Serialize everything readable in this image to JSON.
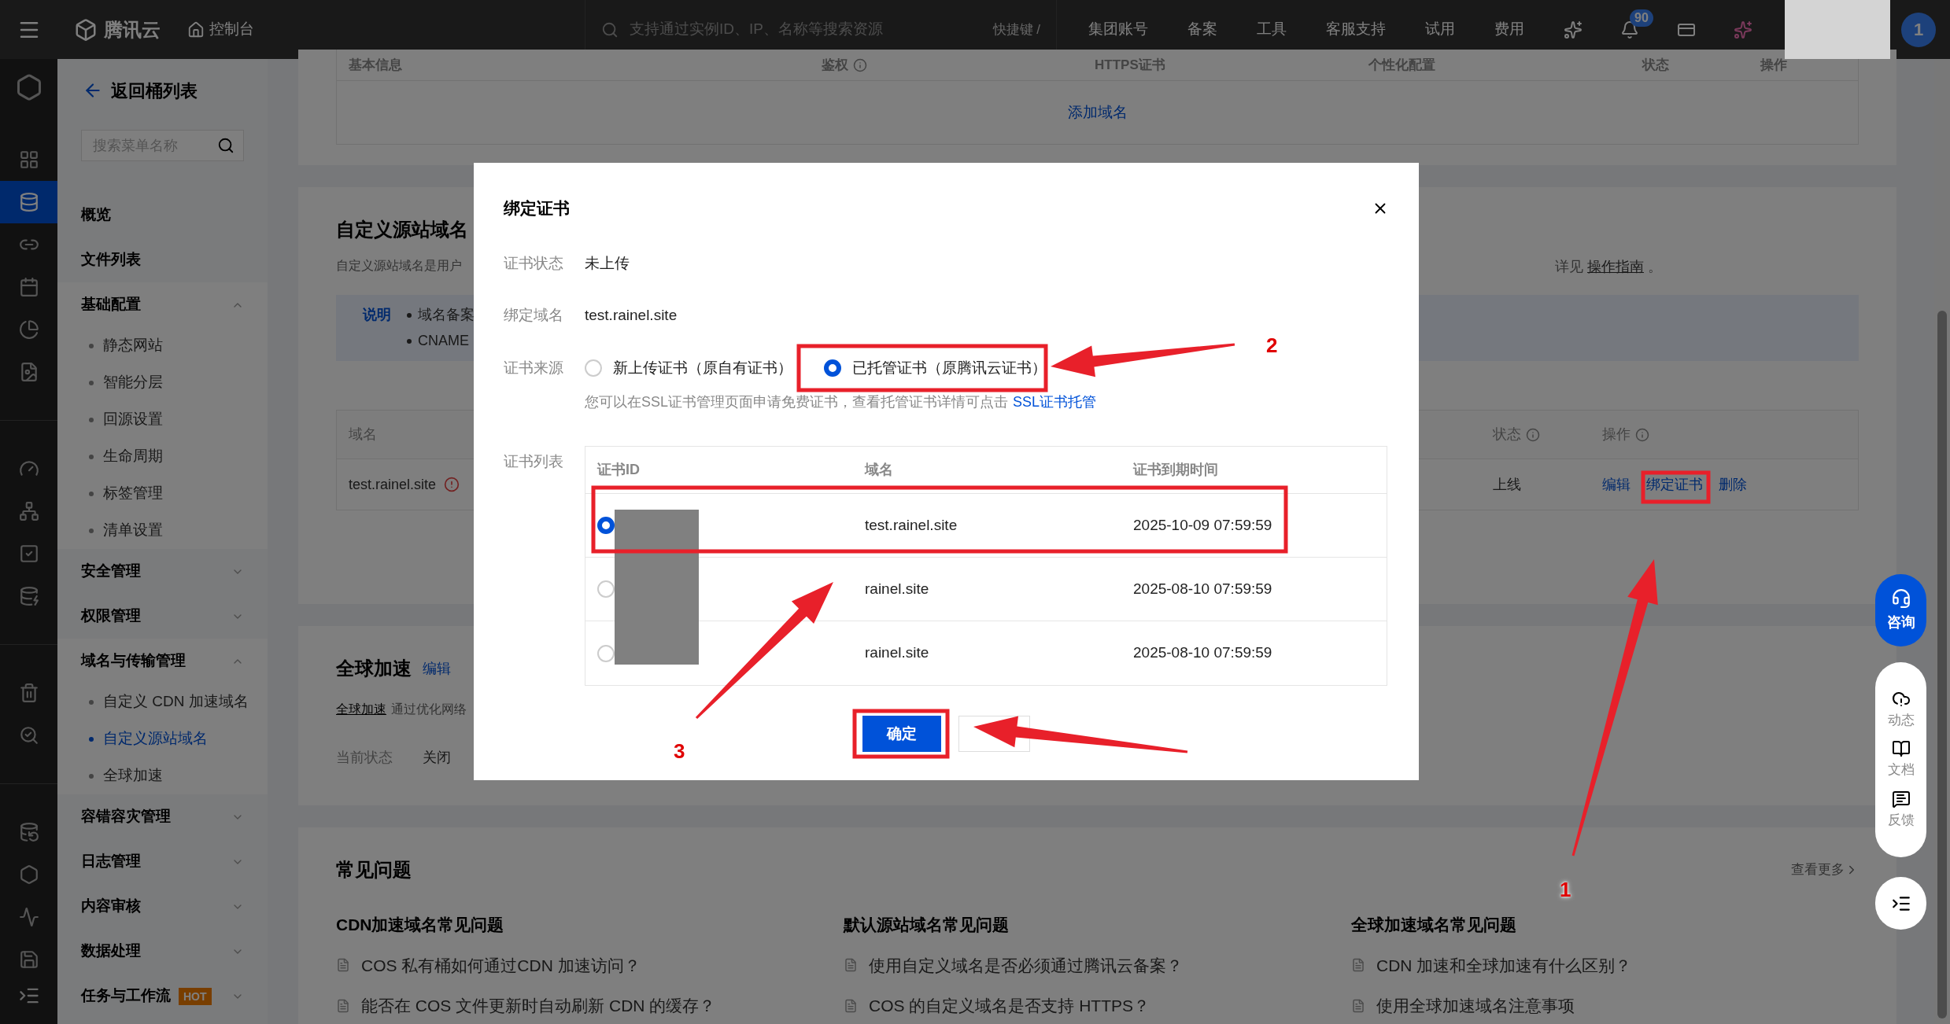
{
  "top_bar": {
    "logo": "腾讯云",
    "console": "控制台",
    "search": {
      "placeholder": "支持通过实例ID、IP、名称等搜索资源"
    },
    "shortcut": "快捷键 /",
    "nav": [
      "集团账号",
      "备案",
      "工具",
      "客服支持",
      "试用",
      "费用"
    ],
    "notification_count": "90",
    "avatar": "1"
  },
  "icon_rail": {
    "groups": [
      [
        {
          "selected": false
        },
        {
          "selected": true
        },
        {
          "selected": false
        },
        {
          "selected": false
        },
        {
          "selected": false
        },
        {
          "selected": false
        }
      ],
      [
        {
          "selected": false
        },
        {
          "selected": false
        },
        {
          "selected": false
        },
        {
          "selected": false
        }
      ],
      [
        {
          "selected": false
        },
        {
          "selected": false
        }
      ],
      [
        {
          "selected": false
        },
        {
          "selected": false
        },
        {
          "selected": false
        },
        {
          "selected": false
        }
      ]
    ]
  },
  "sidebar": {
    "back": "返回桶列表",
    "search": {
      "placeholder": "搜索菜单名称"
    },
    "items": [
      {
        "kind": "link",
        "label": "概览",
        "selected": false
      },
      {
        "kind": "link",
        "label": "文件列表",
        "selected": false
      },
      {
        "kind": "group",
        "label": "基础配置",
        "expanded": true,
        "children": [
          {
            "label": "静态网站",
            "selected": false
          },
          {
            "label": "智能分层",
            "selected": false
          },
          {
            "label": "回源设置",
            "selected": false
          },
          {
            "label": "生命周期",
            "selected": false
          },
          {
            "label": "标签管理",
            "selected": false
          },
          {
            "label": "清单设置",
            "selected": false
          }
        ]
      },
      {
        "kind": "group",
        "label": "安全管理",
        "expanded": false
      },
      {
        "kind": "group",
        "label": "权限管理",
        "expanded": false
      },
      {
        "kind": "group",
        "label": "域名与传输管理",
        "expanded": true,
        "children": [
          {
            "label": "自定义 CDN 加速域名",
            "selected": false
          },
          {
            "label": "自定义源站域名",
            "selected": true
          },
          {
            "label": "全球加速",
            "selected": false
          }
        ]
      },
      {
        "kind": "group",
        "label": "容错容灾管理",
        "expanded": false
      },
      {
        "kind": "group",
        "label": "日志管理",
        "expanded": false
      },
      {
        "kind": "group",
        "label": "内容审核",
        "expanded": false
      },
      {
        "kind": "group",
        "label": "数据处理",
        "expanded": false
      },
      {
        "kind": "group",
        "label": "任务与工作流",
        "badge": "HOT",
        "expanded": false
      }
    ]
  },
  "domain_table": {
    "columns": [
      {
        "label": "基本信息",
        "info": false
      },
      {
        "label": "鉴权",
        "info": true
      },
      {
        "label": "HTTPS证书",
        "info": false
      },
      {
        "label": "个性化配置",
        "info": false
      },
      {
        "label": "状态",
        "info": false
      },
      {
        "label": "操作",
        "info": false
      }
    ],
    "add_link": "添加域名"
  },
  "custom_origin": {
    "title": "自定义源站域名",
    "description": "自定义源站域名是用户",
    "description_tail": "详见",
    "guide_link": "操作指南",
    "guide_end": "。",
    "notice": {
      "label": "说明",
      "bullets": [
        "域名备案",
        "CNAME"
      ]
    },
    "table": {
      "columns": [
        {
          "label": "域名",
          "info": false
        },
        {
          "label": "状态",
          "info": true
        },
        {
          "label": "操作",
          "info": true
        }
      ],
      "rows": [
        {
          "domain": "test.rainel.site",
          "warning": true,
          "status": "上线",
          "actions": [
            "编辑",
            "绑定证书",
            "删除"
          ]
        }
      ]
    }
  },
  "global_acceleration": {
    "title": "全球加速",
    "edit": "编辑",
    "link": "全球加速",
    "text": "通过优化网络",
    "status_label": "当前状态",
    "status_value": "关闭"
  },
  "faq": {
    "title": "常见问题",
    "more": "查看更多",
    "columns": [
      {
        "heading": "CDN加速域名常见问题",
        "items": [
          "COS 私有桶如何通过CDN 加速访问？",
          "能否在 COS 文件更新时自动刷新 CDN 的缓存？"
        ]
      },
      {
        "heading": "默认源站域名常见问题",
        "items": [
          "使用自定义域名是否必须通过腾讯云备案？",
          "COS 的自定义域名是否支持 HTTPS？"
        ]
      },
      {
        "heading": "全球加速域名常见问题",
        "items": [
          "CDN 加速和全球加速有什么区别？",
          "使用全球加速域名注意事项"
        ]
      }
    ]
  },
  "float_buttons": {
    "consult": "咨询",
    "tools": [
      "动态",
      "文档",
      "反馈"
    ]
  },
  "modal": {
    "title": "绑定证书",
    "fields": [
      {
        "label": "证书状态",
        "value": "未上传"
      },
      {
        "label": "绑定域名",
        "value": "test.rainel.site"
      }
    ],
    "source": {
      "label": "证书来源",
      "options": [
        {
          "label": "新上传证书（原自有证书）",
          "selected": false
        },
        {
          "label": "已托管证书（原腾讯云证书）",
          "selected": true
        }
      ],
      "hint": "您可以在SSL证书管理页面申请免费证书，查看托管证书详情可点击",
      "hint_link": "SSL证书托管"
    },
    "cert_list": {
      "label": "证书列表",
      "columns": [
        "证书ID",
        "域名",
        "证书到期时间"
      ],
      "rows": [
        {
          "selected": true,
          "domain": "test.rainel.site",
          "expires": "2025-10-09 07:59:59"
        },
        {
          "selected": false,
          "domain": "rainel.site",
          "expires": "2025-08-10 07:59:59"
        },
        {
          "selected": false,
          "domain": "rainel.site",
          "expires": "2025-08-10 07:59:59"
        }
      ]
    },
    "confirm": "确定"
  },
  "annotations": {
    "labels": [
      "1",
      "2",
      "3"
    ]
  }
}
